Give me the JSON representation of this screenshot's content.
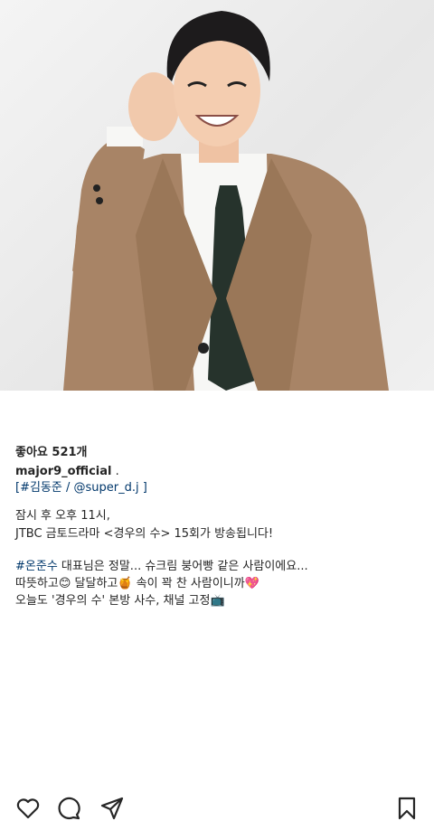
{
  "post": {
    "likes": "좋아요 521개",
    "username": "major9_official",
    "username_suffix": " .",
    "mentions_line": "[#김동준 / @super_d.j ]",
    "caption": [
      "잠시 후 오후 11시,",
      "JTBC 금토드라마 <경우의 수> 15회가 방송됩니다!",
      "",
      "#온준수 대표님은 정말... 슈크림 붕어빵 같은 사람이에요...",
      "따뜻하고😊 달달하고🍯 속이 꽉 찬 사람이니까💖",
      "오늘도 '경우의 수' 본방 사수, 채널 고정📺"
    ]
  },
  "icons": [
    "heart-icon",
    "comment-icon",
    "share-icon",
    "bookmark-icon"
  ],
  "colors": {
    "link": "#00376b",
    "text": "#262626",
    "jacket": "#a88466",
    "tie": "#26332c"
  }
}
